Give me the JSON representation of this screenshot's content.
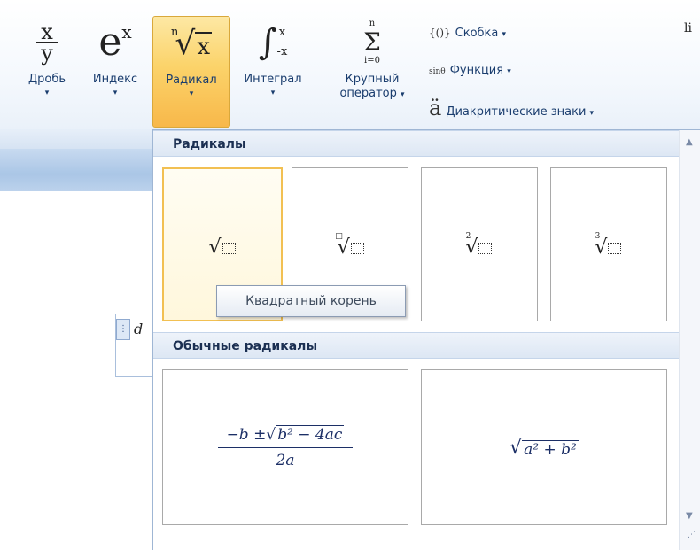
{
  "ribbon": {
    "buttons": [
      {
        "label": "Дробь",
        "icon": "fraction-icon",
        "glyph_num": "x",
        "glyph_den": "y"
      },
      {
        "label": "Индекс",
        "icon": "script-icon",
        "glyph_base": "e",
        "glyph_sup": "x"
      },
      {
        "label": "Радикал",
        "icon": "radical-icon",
        "glyph_index": "n",
        "glyph_base": "x",
        "active": true
      },
      {
        "label": "Интеграл",
        "icon": "integral-icon",
        "glyph_upper": "x",
        "glyph_lower": "-x"
      },
      {
        "label_line1": "Крупный",
        "label_line2": "оператор",
        "icon": "sum-icon",
        "glyph_upper": "n",
        "glyph_lower": "i=0"
      }
    ],
    "small_items": [
      {
        "label": "Скобка",
        "icon": "bracket-icon",
        "glyph": "{()}"
      },
      {
        "label": "Функция",
        "icon": "function-icon",
        "glyph": "sinθ"
      },
      {
        "label": "Диакритические знаки",
        "icon": "accent-icon",
        "glyph": "ä"
      }
    ],
    "dropdown_arrow": "▾",
    "cut_label": "li"
  },
  "gallery": {
    "section1_title": "Радикалы",
    "section2_title": "Обычные радикалы",
    "tooltip": "Квадратный корень",
    "tiles": [
      {
        "name": "square-root",
        "index": ""
      },
      {
        "name": "nth-root",
        "index": "□"
      },
      {
        "name": "square-root-with-degree",
        "index": "2"
      },
      {
        "name": "cube-root",
        "index": "3"
      }
    ],
    "formulas": {
      "quadratic_num_left": "−b ± ",
      "quadratic_radicand": "b² − 4ac",
      "quadratic_den": "2a",
      "pythag_radicand": "a² + b²"
    },
    "scroll_up": "▲",
    "scroll_down": "▼",
    "grip": "⋰"
  },
  "document": {
    "equation_char": "d",
    "handle_glyph": "⋮"
  },
  "colors": {
    "active_button": "#fbd36a",
    "ribbon_text": "#1a3d6e",
    "section_header": "#dde7f4"
  }
}
